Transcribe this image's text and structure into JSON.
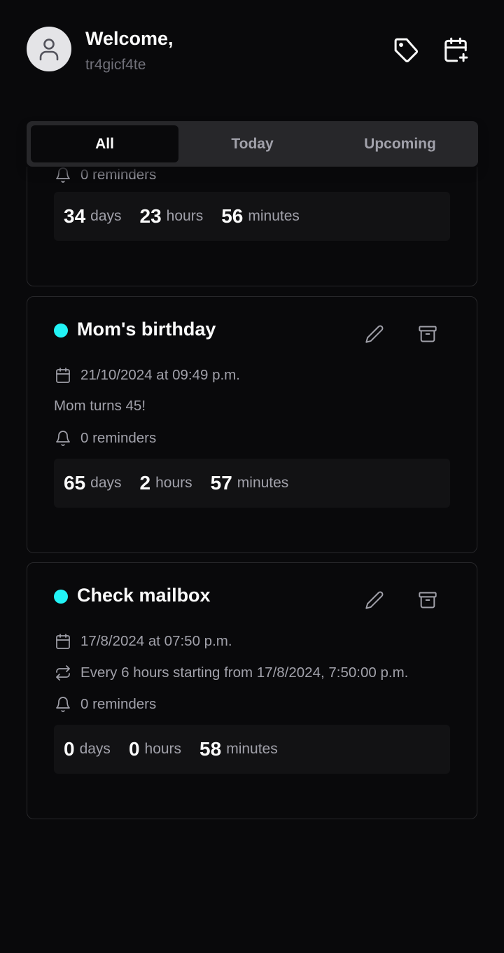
{
  "header": {
    "greeting": "Welcome,",
    "username": "tr4gicf4te",
    "avatar_icon": "user-icon",
    "tags_icon": "tag-icon",
    "add_event_icon": "calendar-plus-icon"
  },
  "tabs": [
    {
      "label": "All",
      "active": true
    },
    {
      "label": "Today",
      "active": false
    },
    {
      "label": "Upcoming",
      "active": false
    }
  ],
  "accent_color": "#22f3f6",
  "events": [
    {
      "title": "",
      "reminders": "0 reminders",
      "countdown": {
        "days": "34",
        "days_label": "days",
        "hours": "23",
        "hours_label": "hours",
        "minutes": "56",
        "minutes_label": "minutes"
      }
    },
    {
      "title": "Mom's birthday",
      "date": "21/10/2024 at 09:49 p.m.",
      "description": "Mom turns 45!",
      "reminders": "0 reminders",
      "countdown": {
        "days": "65",
        "days_label": "days",
        "hours": "2",
        "hours_label": "hours",
        "minutes": "57",
        "minutes_label": "minutes"
      }
    },
    {
      "title": "Check mailbox",
      "date": "17/8/2024 at 07:50 p.m.",
      "repeat": "Every 6 hours starting from 17/8/2024, 7:50:00 p.m.",
      "reminders": "0 reminders",
      "countdown": {
        "days": "0",
        "days_label": "days",
        "hours": "0",
        "hours_label": "hours",
        "minutes": "58",
        "minutes_label": "minutes"
      }
    }
  ]
}
